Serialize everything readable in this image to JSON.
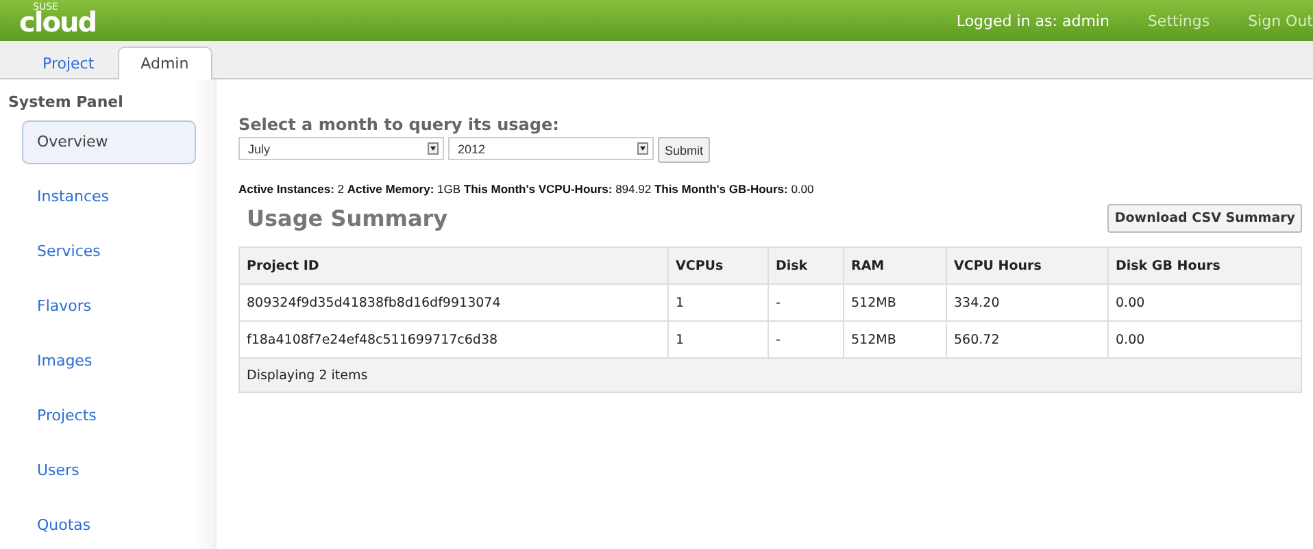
{
  "header": {
    "logo_small": "SUSE",
    "logo": "cloud",
    "user": "Logged in as: admin",
    "links": [
      "Settings",
      "Sign Out"
    ]
  },
  "tabs": [
    {
      "label": "Project",
      "selected": false
    },
    {
      "label": "Admin",
      "selected": true
    }
  ],
  "sidebar": {
    "title": "System Panel",
    "items": [
      {
        "label": "Overview",
        "selected": true
      },
      {
        "label": "Instances",
        "selected": false
      },
      {
        "label": "Services",
        "selected": false
      },
      {
        "label": "Flavors",
        "selected": false
      },
      {
        "label": "Images",
        "selected": false
      },
      {
        "label": "Projects",
        "selected": false
      },
      {
        "label": "Users",
        "selected": false
      },
      {
        "label": "Quotas",
        "selected": false
      }
    ]
  },
  "query": {
    "heading": "Select a month to query its usage:",
    "month": "July",
    "year": "2012",
    "submit": "Submit"
  },
  "stats": "**Active Instances:** 2 **Active Memory:** 1GB **This Month's VCPU-Hours:** 894.92 **This Month's GB-Hours:** 0.00",
  "summary": {
    "title": "Usage Summary",
    "download": "Download CSV Summary"
  },
  "table": {
    "columns": [
      "Project ID",
      "VCPUs",
      "Disk",
      "RAM",
      "VCPU Hours",
      "Disk GB Hours"
    ],
    "rows": [
      [
        "809324f9d35d41838fb8d16df9913074",
        "1",
        "-",
        "512MB",
        "334.20",
        "0.00"
      ],
      [
        "f18a4108f7e24ef48c511699717c6d38",
        "1",
        "-",
        "512MB",
        "560.72",
        "0.00"
      ]
    ],
    "footer": "Displaying 2 items"
  }
}
